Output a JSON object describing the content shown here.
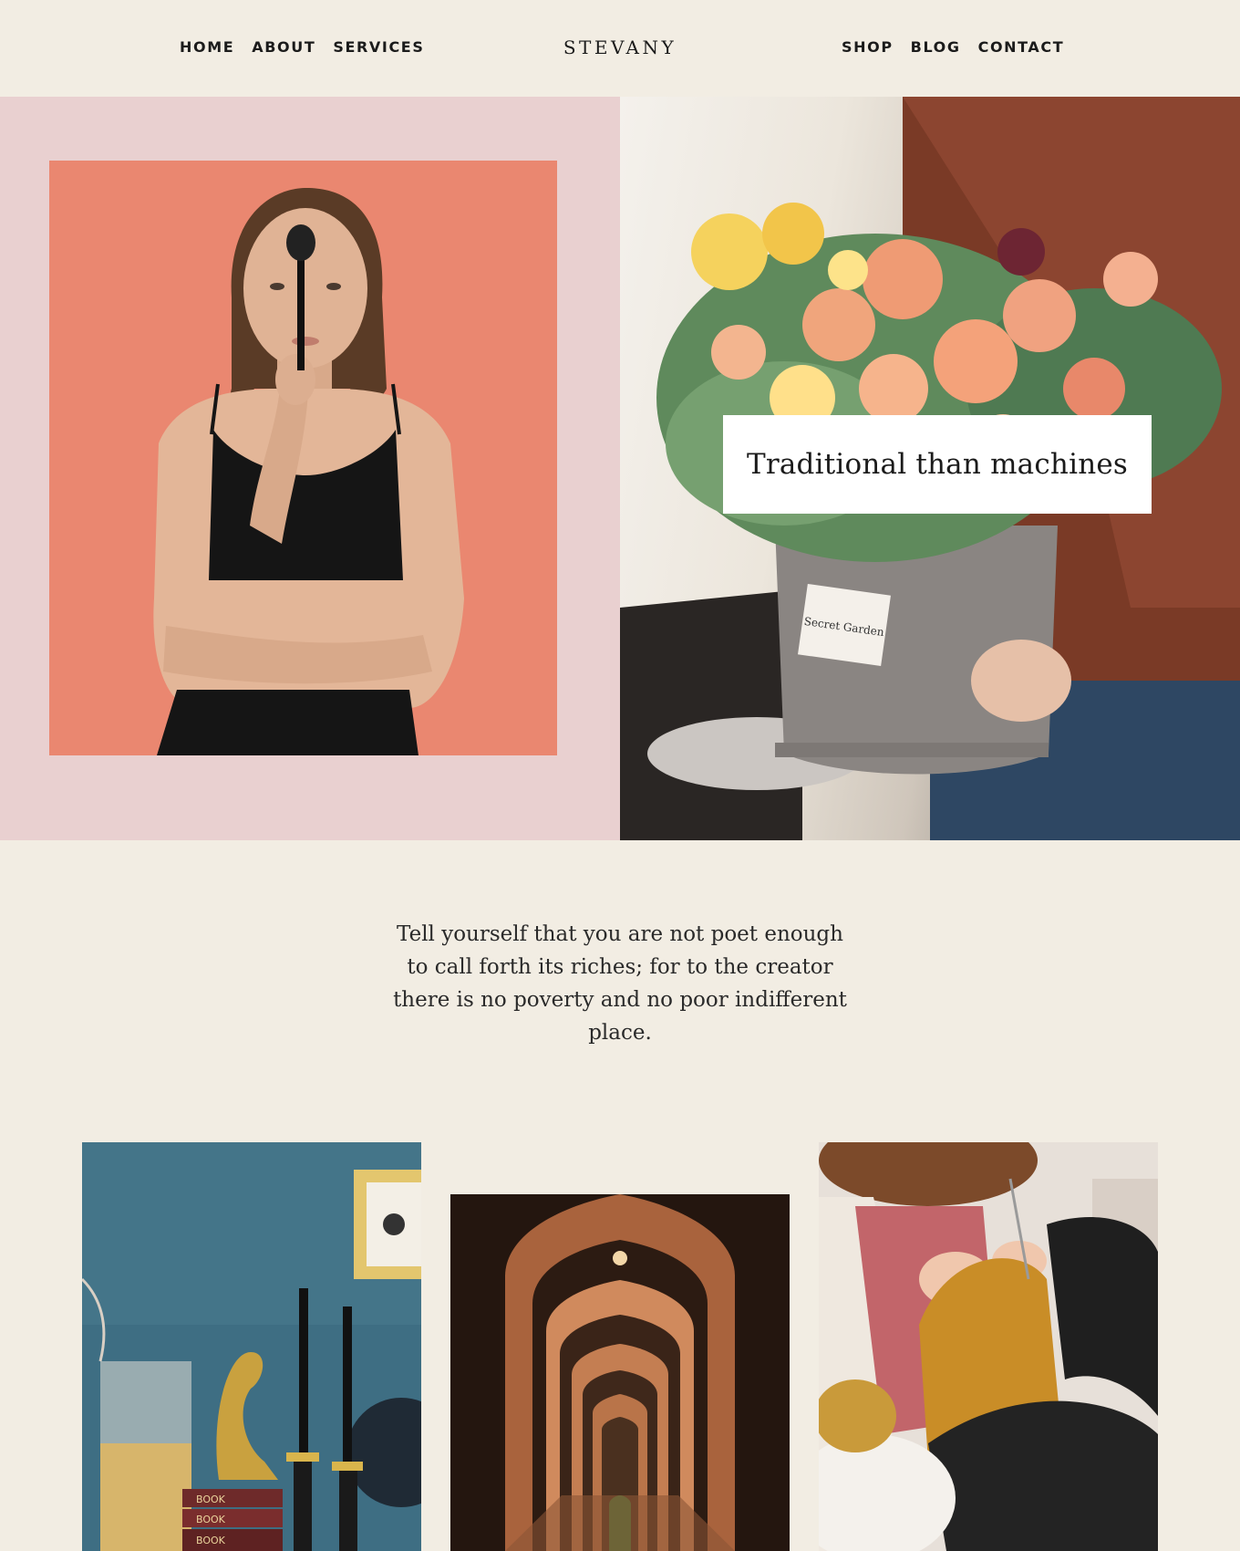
{
  "nav": {
    "left": [
      {
        "label": "HOME"
      },
      {
        "label": "ABOUT"
      },
      {
        "label": "SERVICES"
      }
    ],
    "right": [
      {
        "label": "SHOP"
      },
      {
        "label": "BLOG"
      },
      {
        "label": "CONTACT"
      }
    ]
  },
  "brand": {
    "name": "STEVANY"
  },
  "hero": {
    "caption": "Traditional than machines",
    "box_label": "Secret Garden"
  },
  "quote": {
    "text": "Tell yourself that you are not poet enough to call forth its riches; for to the creator there is no poverty and no poor indifferent place."
  },
  "gallery": {
    "book_labels": [
      "BOOK",
      "BOOK",
      "BOOK"
    ]
  },
  "colors": {
    "background": "#f2ede3",
    "hero_left_bg": "#e9d0d0",
    "portrait_bg": "#ea8770",
    "caption_bg": "#ffffff",
    "text": "#1b1b1b"
  }
}
